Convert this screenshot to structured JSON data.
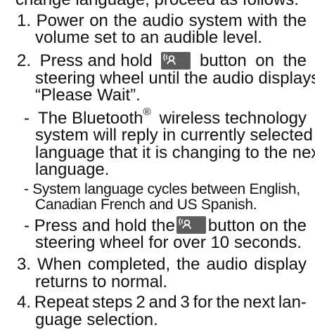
{
  "doc": {
    "top_clipped_line": "change language, proceed as follows:",
    "step1": {
      "number": "1.",
      "line1_words": [
        "Power",
        "on",
        "the",
        "audio",
        "system",
        "with",
        "the"
      ],
      "line2": "volume set to an audible level."
    },
    "step2": {
      "number": "2.",
      "line1_before_icon": "Press and hold",
      "line1_after_icon": [
        "button",
        "on",
        "the"
      ],
      "line2": "steering wheel until the audio displays",
      "line3": "“Please Wait”."
    },
    "subitem1": {
      "dash": "-",
      "line1_before_sup": "The Bluetooth",
      "sup": "®",
      "line1_after_sup": "wireless technology",
      "line2": "system will reply in currently selected",
      "line3": "language that it is changing to the next",
      "line4": "language."
    },
    "subitem2": {
      "line1": "- System language cycles between English,",
      "line2": "Canadian French and US Spanish."
    },
    "subitem3": {
      "line1_before_icon": "- Press and hold the",
      "line1_after_icon": "button on the",
      "line2": "steering wheel for over 10 seconds."
    },
    "step3": {
      "line1_words": [
        "3.",
        "When",
        "completed,",
        "the",
        "audio",
        "display"
      ],
      "line2": "returns to normal."
    },
    "step4": {
      "line1_words": [
        "4.",
        "Repeat",
        "steps",
        "2",
        "and",
        "3",
        "for",
        "the",
        "next",
        "lan-"
      ],
      "line2": "guage selection."
    },
    "icons": {
      "voice_button": "voice-command-icon",
      "button_color": "#5c5c5c",
      "glyph_color": "#ffffff"
    }
  }
}
